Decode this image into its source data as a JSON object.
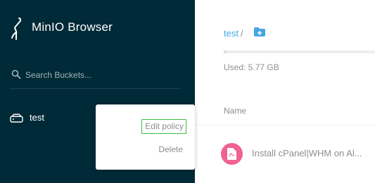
{
  "app": {
    "title": "MinIO Browser"
  },
  "sidebar": {
    "search": {
      "placeholder": "Search Buckets..."
    },
    "buckets": [
      {
        "name": "test"
      }
    ]
  },
  "context_menu": {
    "items": [
      {
        "label": "Edit policy"
      },
      {
        "label": "Delete"
      }
    ]
  },
  "main": {
    "breadcrumb": {
      "bucket": "test",
      "separator": "/"
    },
    "storage": {
      "used_label": "Used: 5.77 GB",
      "progress": 0.02
    },
    "table": {
      "columns": [
        "Name"
      ],
      "rows": [
        {
          "name": "Install cPanel|WHM on Al..."
        }
      ]
    }
  },
  "colors": {
    "sidebar_bg": "#002a37",
    "accent": "#46a5e5",
    "file_icon": "#f06292",
    "focus_outline": "#3dbd3d"
  },
  "icons": [
    "minio-logo",
    "search-icon",
    "bucket-icon",
    "folder-add-icon",
    "file-pdf-icon"
  ]
}
